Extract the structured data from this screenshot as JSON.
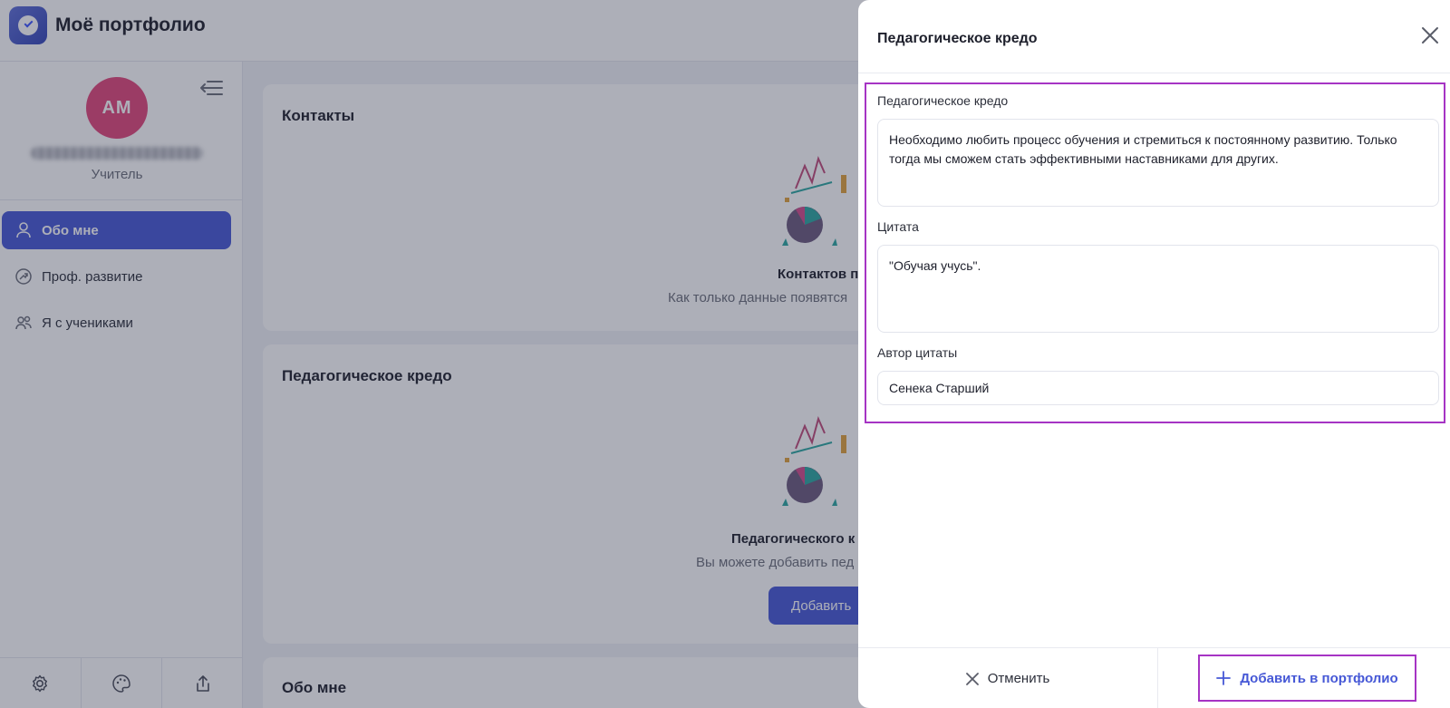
{
  "app": {
    "title": "Моё портфолио"
  },
  "sidebar": {
    "avatar_initials": "АМ",
    "role": "Учитель",
    "items": [
      {
        "label": "Обо мне",
        "icon": "user-icon",
        "active": true
      },
      {
        "label": "Проф. развитие",
        "icon": "growth-icon",
        "active": false
      },
      {
        "label": "Я с учениками",
        "icon": "users-icon",
        "active": false
      }
    ],
    "bottom_icons": [
      "settings-icon",
      "palette-icon",
      "share-icon"
    ]
  },
  "main": {
    "contacts": {
      "title": "Контакты",
      "empty_title": "Контактов п",
      "empty_sub": "Как только данные появятся"
    },
    "credo": {
      "title": "Педагогическое кредо",
      "empty_title": "Педагогического к",
      "empty_sub": "Вы можете добавить пед",
      "button": "Добавить"
    },
    "about": {
      "title": "Обо мне"
    }
  },
  "drawer": {
    "title": "Педагогическое кредо",
    "fields": {
      "credo": {
        "label": "Педагогическое кредо",
        "value": "Необходимо любить процесс обучения и стремиться к постоянному развитию. Только тогда мы сможем стать эффективными наставниками для других."
      },
      "quote": {
        "label": "Цитата",
        "value": "\"Обучая учусь\"."
      },
      "author": {
        "label": "Автор цитаты",
        "value": "Сенека Старший"
      }
    },
    "cancel_label": "Отменить",
    "submit_label": "Добавить в портфолио"
  },
  "colors": {
    "accent": "#4658d6",
    "avatar": "#e2467a",
    "highlight": "#a634c4"
  }
}
